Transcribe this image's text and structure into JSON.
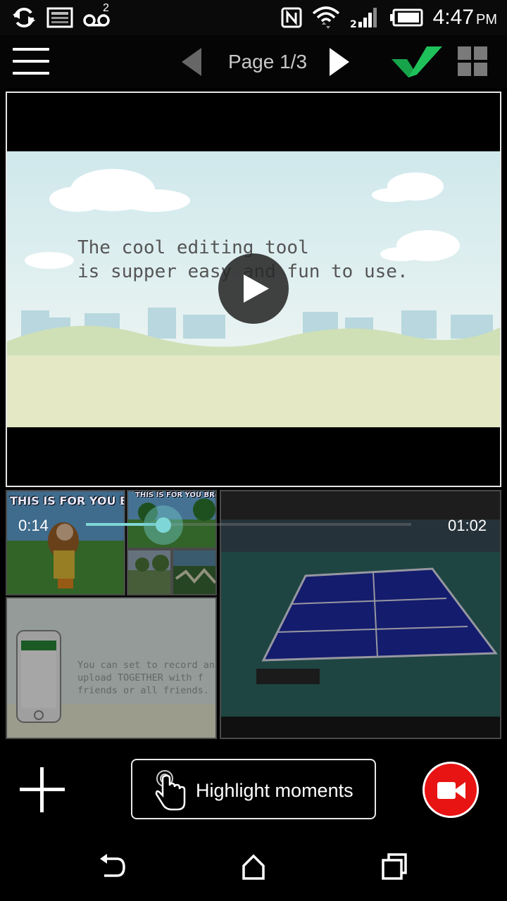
{
  "status_bar": {
    "voicemail_count": "2",
    "time": "4:47",
    "ampm": "PM",
    "icons": [
      "sync-icon",
      "image-notification-icon",
      "voicemail-icon",
      "nfc-icon",
      "wifi-icon",
      "signal-icon",
      "battery-icon"
    ]
  },
  "app_bar": {
    "page_label": "Page 1/3",
    "icons": [
      "menu-icon",
      "prev-page-icon",
      "next-page-icon",
      "checkmark-icon",
      "grid-view-icon"
    ],
    "accent_color": "#1db954"
  },
  "main_video": {
    "caption": "The cool editing tool\nis supper easy and fun to use.",
    "icons": [
      "play-icon"
    ]
  },
  "thumbnails": {
    "t1_text": "THIS IS FOR YOU BRO!",
    "t2_text": "THIS IS FOR YOU BRO!",
    "t5_text": "You can set to record an\nupload TOGETHER with f\nfriends or all friends."
  },
  "playback": {
    "current_time": "0:14",
    "total_time": "01:02",
    "progress": 0.23,
    "accent_color": "#7fd6d6"
  },
  "toolbar": {
    "highlight_label": "Highlight moments",
    "record_color": "#e81313",
    "icons": [
      "add-icon",
      "touch-hand-icon",
      "video-camera-icon"
    ]
  },
  "nav_bar": {
    "icons": [
      "back-icon",
      "home-icon",
      "recent-apps-icon"
    ]
  }
}
